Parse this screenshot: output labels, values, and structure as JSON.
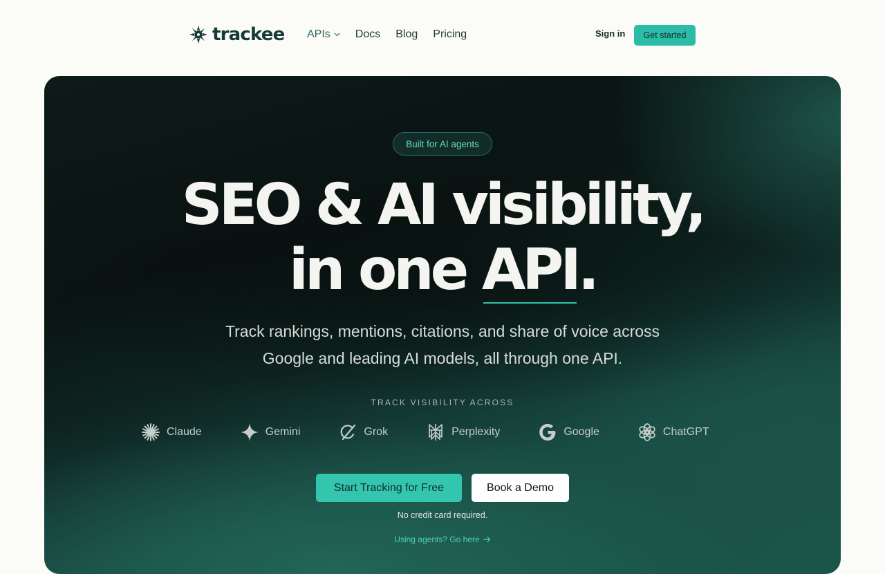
{
  "brand": {
    "name": "trackee"
  },
  "nav": {
    "links": [
      {
        "label": "APIs"
      },
      {
        "label": "Docs"
      },
      {
        "label": "Blog"
      },
      {
        "label": "Pricing"
      }
    ],
    "sign_in": "Sign in",
    "get_started": "Get started"
  },
  "hero": {
    "badge": "Built for AI agents",
    "headline_line1": "SEO & AI visibility,",
    "headline_line2_prefix": "in one ",
    "headline_line2_highlight": "API",
    "headline_line2_suffix": ".",
    "subhead": "Track rankings, mentions, citations, and share of voice across Google and leading AI models, all through one API.",
    "track_label": "TRACK VISIBILITY ACROSS",
    "platforms": [
      {
        "name": "Claude",
        "icon": "claude-icon"
      },
      {
        "name": "Gemini",
        "icon": "gemini-icon"
      },
      {
        "name": "Grok",
        "icon": "grok-icon"
      },
      {
        "name": "Perplexity",
        "icon": "perplexity-icon"
      },
      {
        "name": "Google",
        "icon": "google-icon"
      },
      {
        "name": "ChatGPT",
        "icon": "chatgpt-icon"
      }
    ],
    "cta_primary": "Start Tracking for Free",
    "cta_secondary": "Book a Demo",
    "note": "No credit card required.",
    "agents_link": "Using agents? Go here"
  },
  "colors": {
    "accent": "#33c5ae",
    "brand_dark": "#163a36",
    "hero_dark": "#0a1412",
    "hero_green": "#1b5549"
  }
}
